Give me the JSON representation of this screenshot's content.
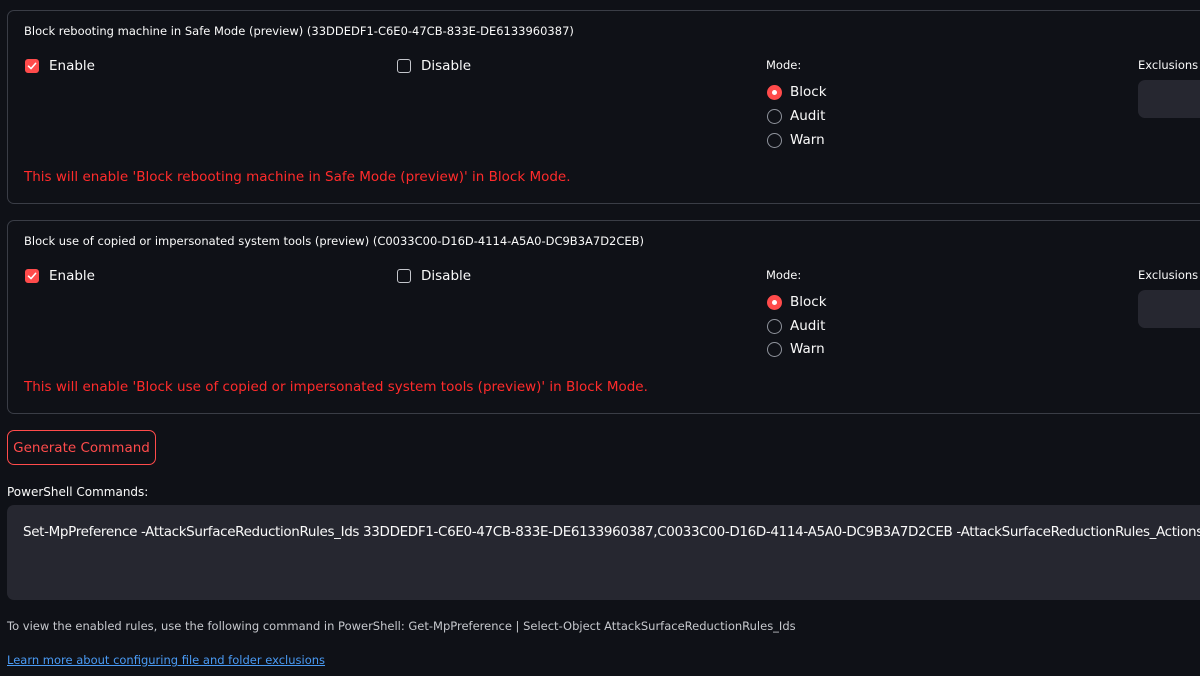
{
  "rules": [
    {
      "title": "Block rebooting machine in Safe Mode (preview) (33DDEDF1-C6E0-47CB-833E-DE6133960387)",
      "enable_label": "Enable",
      "disable_label": "Disable",
      "enable_checked": true,
      "disable_checked": false,
      "mode_label": "Mode:",
      "modes": [
        "Block",
        "Audit",
        "Warn"
      ],
      "selected_mode": "Block",
      "exclusions_label": "Exclusions (",
      "note": "This will enable 'Block rebooting machine in Safe Mode (preview)' in Block Mode."
    },
    {
      "title": "Block use of copied or impersonated system tools (preview) (C0033C00-D16D-4114-A5A0-DC9B3A7D2CEB)",
      "enable_label": "Enable",
      "disable_label": "Disable",
      "enable_checked": true,
      "disable_checked": false,
      "mode_label": "Mode:",
      "modes": [
        "Block",
        "Audit",
        "Warn"
      ],
      "selected_mode": "Block",
      "exclusions_label": "Exclusions (",
      "note": "This will enable 'Block use of copied or impersonated system tools (preview)' in Block Mode."
    }
  ],
  "generate_button_label": "Generate Command",
  "powershell": {
    "label": "PowerShell Commands:",
    "command": "Set-MpPreference -AttackSurfaceReductionRules_Ids 33DDEDF1-C6E0-47CB-833E-DE6133960387,C0033C00-D16D-4114-A5A0-DC9B3A7D2CEB -AttackSurfaceReductionRules_Actions Enabled"
  },
  "hint": "To view the enabled rules, use the following command in PowerShell: Get-MpPreference | Select-Object AttackSurfaceReductionRules_Ids",
  "learn_more_link": "Learn more about configuring file and folder exclusions",
  "colors": {
    "background": "#0f1117",
    "accent": "#ff4b4b",
    "note_text": "#ff2b2b",
    "link": "#4a9bf5",
    "input_bg": "#262730"
  }
}
